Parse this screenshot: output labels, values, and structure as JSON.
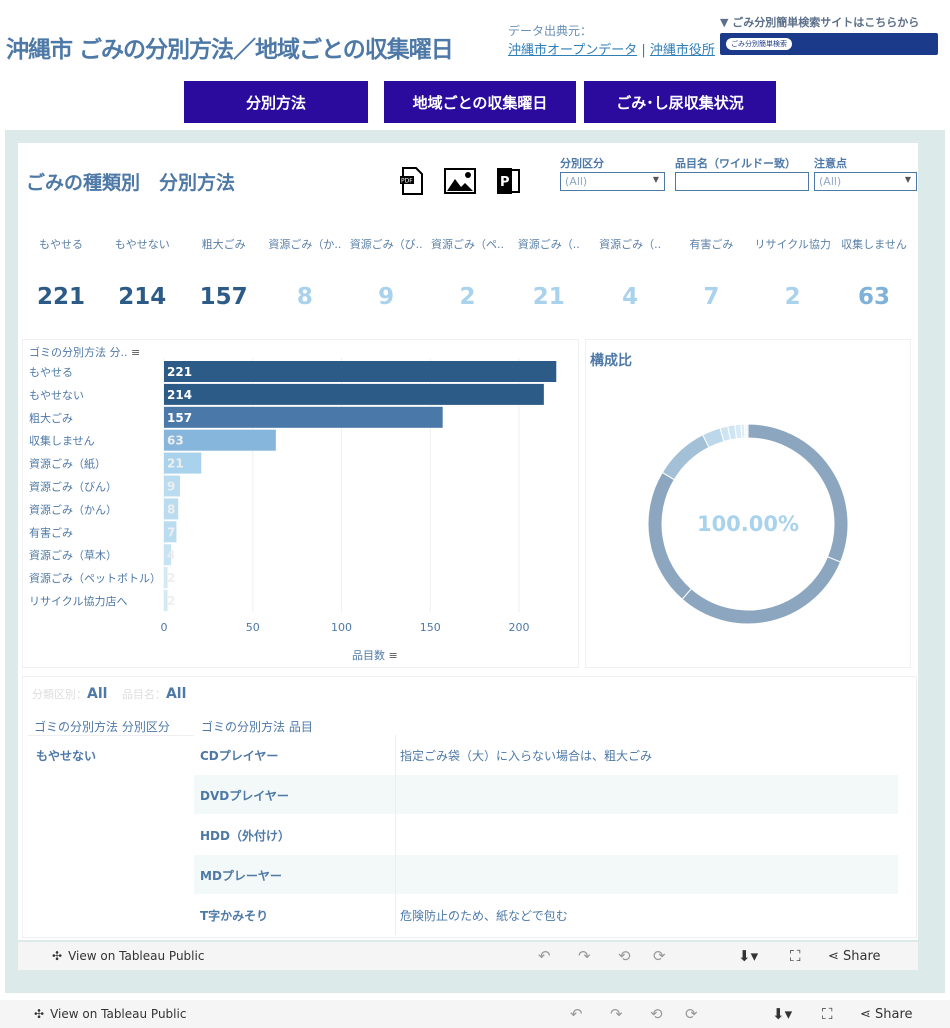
{
  "header": {
    "title": "沖縄市 ごみの分別方法／地域ごとの収集曜日",
    "source_label": "データ出典元：",
    "source_link1": "沖縄市オープンデータ",
    "source_sep": "|",
    "source_link2": "沖縄市役所",
    "search_site_label": "▼ ごみ分別簡単検索サイトはこちらから",
    "banner_text": "ごみ分別簡単検索"
  },
  "nav": [
    "分別方法",
    "地域ごとの収集曜日",
    "ごみ･し尿収集状況"
  ],
  "sheet": {
    "title": "ごみの種類別　分別方法",
    "icons": [
      "pdf-icon",
      "image-icon",
      "powerpoint-icon"
    ]
  },
  "filters": [
    {
      "label": "分別区分",
      "value": "(All)"
    },
    {
      "label": "品目名（ワイルドー致）",
      "value": ""
    },
    {
      "label": "注意点",
      "value": "(All)"
    }
  ],
  "kpis": [
    {
      "label": "もやせる",
      "value": "221"
    },
    {
      "label": "もやせない",
      "value": "214"
    },
    {
      "label": "粗大ごみ",
      "value": "157"
    },
    {
      "label": "資源ごみ（か..",
      "value": "8"
    },
    {
      "label": "資源ごみ（び..",
      "value": "9"
    },
    {
      "label": "資源ごみ（ペ..",
      "value": "2"
    },
    {
      "label": "資源ごみ（..",
      "value": "21"
    },
    {
      "label": "資源ごみ（..",
      "value": "4"
    },
    {
      "label": "有害ごみ",
      "value": "7"
    },
    {
      "label": "リサイクル協力",
      "value": "2"
    },
    {
      "label": "収集しません",
      "value": "63"
    }
  ],
  "chart_data": {
    "type": "bar",
    "header": "ゴミの分別方法 分..",
    "categories": [
      "もやせる",
      "もやせない",
      "粗大ごみ",
      "収集しません",
      "資源ごみ（紙）",
      "資源ごみ（びん）",
      "資源ごみ（かん）",
      "有害ごみ",
      "資源ごみ（草木）",
      "資源ごみ（ペットボトル）",
      "リサイクル協力店へ"
    ],
    "values": [
      221,
      214,
      157,
      63,
      21,
      9,
      8,
      7,
      4,
      2,
      2
    ],
    "xlabel": "品目数",
    "ticks": [
      "0",
      "50",
      "100",
      "150",
      "200"
    ],
    "xlim": [
      0,
      240
    ],
    "colors": [
      "#2d5b87",
      "#2d5b87",
      "#4a78a8",
      "#86b6dc",
      "#a9d2ec",
      "#b9dcf0",
      "#b9dcf0",
      "#b9dcf0",
      "#c6e3f3",
      "#d3e9f6",
      "#d3e9f6"
    ]
  },
  "donut": {
    "title": "構成比",
    "center_label": "100.00%",
    "colors": [
      "#8da6bf",
      "#8da6bf",
      "#8da6bf",
      "#a4c0d6",
      "#bcd7ea",
      "#cfe4f2",
      "#cfe4f2",
      "#d8eaf5",
      "#ddedf6",
      "#e3f0f8",
      "#e3f0f8"
    ]
  },
  "detail": {
    "filter_summary_label1": "分類区別：",
    "filter_summary_value1": "All",
    "filter_summary_label2": "品目名：",
    "filter_summary_value2": "All",
    "col1": "ゴミの分別方法 分別区分",
    "col2": "ゴミの分別方法 品目",
    "group": "もやせない",
    "rows": [
      {
        "item": "CDプレイヤー",
        "note": "指定ごみ袋（大）に入らない場合は、粗大ごみ"
      },
      {
        "item": "DVDプレイヤー",
        "note": ""
      },
      {
        "item": "HDD（外付け）",
        "note": ""
      },
      {
        "item": "MDプレーヤー",
        "note": ""
      },
      {
        "item": "T字かみそり",
        "note": "危険防止のため、紙などで包む"
      }
    ]
  },
  "toolbar": {
    "view_label": "View on Tableau Public",
    "share_label": "Share"
  }
}
